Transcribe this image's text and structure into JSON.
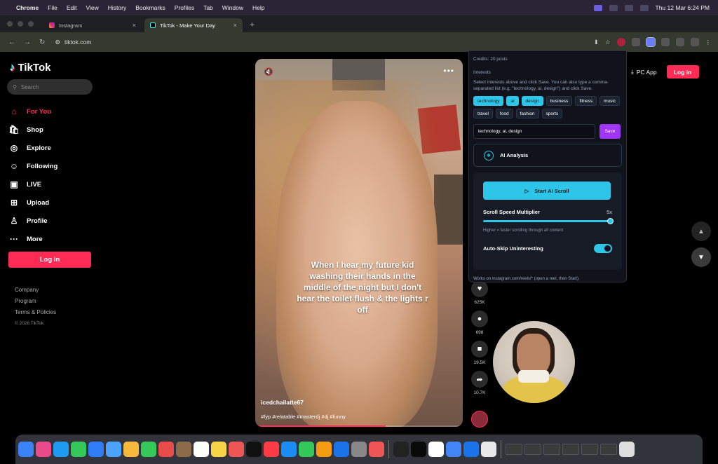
{
  "macos": {
    "menu": [
      "Chrome",
      "File",
      "Edit",
      "View",
      "History",
      "Bookmarks",
      "Profiles",
      "Tab",
      "Window",
      "Help"
    ],
    "clock": "Thu 12 Mar  6:24 PM"
  },
  "browser": {
    "tabs": [
      {
        "title": "Instagram",
        "active": false
      },
      {
        "title": "TikTok - Make Your Day",
        "active": true
      }
    ],
    "url": "tiktok.com"
  },
  "tiktok": {
    "logo": "TikTok",
    "search_placeholder": "Search",
    "nav": [
      {
        "label": "For You",
        "icon": "home-icon",
        "glyph": "⌂",
        "active": true
      },
      {
        "label": "Shop",
        "icon": "shop-icon",
        "glyph": "🛍",
        "active": false
      },
      {
        "label": "Explore",
        "icon": "compass-icon",
        "glyph": "◎",
        "active": false
      },
      {
        "label": "Following",
        "icon": "following-icon",
        "glyph": "☺",
        "active": false
      },
      {
        "label": "LIVE",
        "icon": "live-icon",
        "glyph": "▣",
        "active": false
      },
      {
        "label": "Upload",
        "icon": "upload-icon",
        "glyph": "⊞",
        "active": false
      },
      {
        "label": "Profile",
        "icon": "profile-icon",
        "glyph": "♙",
        "active": false
      },
      {
        "label": "More",
        "icon": "more-icon",
        "glyph": "···",
        "active": false
      }
    ],
    "login": "Log in",
    "footer": [
      "Company",
      "Program",
      "Terms & Policies"
    ],
    "copyright": "© 2026 TikTok",
    "pc_app": "PC App",
    "top_login": "Log in",
    "video": {
      "caption": "When I hear my future kid washing their hands in the middle of the night but I don't hear the toilet flush & the lights r off",
      "username": "icedchailatte67",
      "hashtags": "#fyp #relatable #masterdj #dj #funny",
      "progress": 0.63
    },
    "actions": [
      {
        "name": "like",
        "icon": "heart-icon",
        "glyph": "♥",
        "count": "625K"
      },
      {
        "name": "comment",
        "icon": "comment-icon",
        "glyph": "●",
        "count": "698"
      },
      {
        "name": "bookmark",
        "icon": "bookmark-icon",
        "glyph": "■",
        "count": "19.5K"
      },
      {
        "name": "share",
        "icon": "share-icon",
        "glyph": "➦",
        "count": "10.7K"
      }
    ]
  },
  "extension": {
    "credits": "Credits: 20 posts",
    "interests_label": "Interests",
    "help": "Select interests above and click Save. You can also type a comma-separated list (e.g. \"technology, ai, design\") and click Save.",
    "chips": [
      {
        "label": "technology",
        "selected": true
      },
      {
        "label": "ai",
        "selected": true
      },
      {
        "label": "design",
        "selected": true
      },
      {
        "label": "business",
        "selected": false
      },
      {
        "label": "fitness",
        "selected": false
      },
      {
        "label": "music",
        "selected": false
      },
      {
        "label": "travel",
        "selected": false
      },
      {
        "label": "food",
        "selected": false
      },
      {
        "label": "fashion",
        "selected": false
      },
      {
        "label": "sports",
        "selected": false
      }
    ],
    "input_value": "technology, ai, design",
    "save": "Save",
    "ai_analysis": "AI Analysis",
    "start_button": "Start AI Scroll",
    "speed_label": "Scroll Speed Multiplier",
    "speed_value": "5x",
    "speed_level": 1.0,
    "speed_hint": "Higher = faster scrolling through all content",
    "auto_skip_label": "Auto-Skip Uninteresting",
    "auto_skip_on": true,
    "footer": "Works on instagram.com/reels/* (open a reel, then Start).",
    "accent": "#2dc6e8",
    "save_color": "#a135f5"
  },
  "colors": {
    "brand": "#fe2c55",
    "accent": "#25f4ee"
  }
}
